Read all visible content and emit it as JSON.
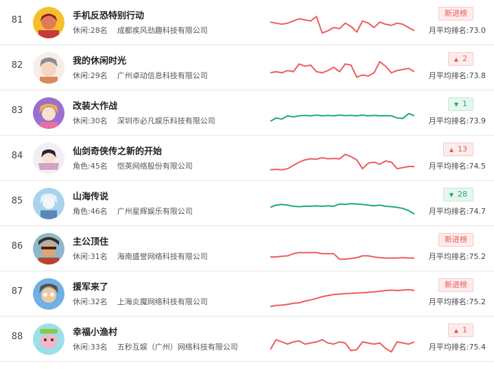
{
  "colors": {
    "up_line": "#ef5a5a",
    "down_line": "#1aaa73"
  },
  "rows": [
    {
      "rank": "81",
      "title": "手机反恐特别行动",
      "category": "休闲:28名",
      "company": "成都疾风劲趣科技有限公司",
      "badge_type": "new",
      "badge_text": "新进榜",
      "avg": "月平均排名:73.0",
      "trend": "red",
      "spark": [
        0.35,
        0.4,
        0.45,
        0.4,
        0.3,
        0.2,
        0.25,
        0.3,
        0.1,
        0.85,
        0.75,
        0.6,
        0.65,
        0.4,
        0.55,
        0.8,
        0.3,
        0.4,
        0.6,
        0.35,
        0.45,
        0.5,
        0.4,
        0.45,
        0.6,
        0.75
      ]
    },
    {
      "rank": "82",
      "title": "我的休闲时光",
      "category": "休闲:29名",
      "company": "广州卓动信息科技有限公司",
      "badge_type": "up",
      "badge_text": "2",
      "avg": "月平均排名:73.8",
      "trend": "red",
      "spark": [
        0.6,
        0.55,
        0.6,
        0.5,
        0.55,
        0.2,
        0.3,
        0.25,
        0.55,
        0.6,
        0.5,
        0.35,
        0.55,
        0.2,
        0.25,
        0.8,
        0.7,
        0.75,
        0.6,
        0.1,
        0.3,
        0.6,
        0.5,
        0.45,
        0.4,
        0.55
      ]
    },
    {
      "rank": "83",
      "title": "改装大作战",
      "category": "休闲:30名",
      "company": "深圳市必凡娱乐科技有限公司",
      "badge_type": "down",
      "badge_text": "1",
      "avg": "月平均排名:73.9",
      "trend": "green",
      "spark": [
        0.75,
        0.6,
        0.65,
        0.5,
        0.55,
        0.5,
        0.48,
        0.5,
        0.47,
        0.5,
        0.48,
        0.5,
        0.47,
        0.49,
        0.48,
        0.5,
        0.47,
        0.5,
        0.48,
        0.5,
        0.49,
        0.5,
        0.6,
        0.62,
        0.4,
        0.5
      ]
    },
    {
      "rank": "84",
      "title": "仙剑奇侠传之新的开始",
      "category": "角色:45名",
      "company": "恺英网络股份有限公司",
      "badge_type": "up",
      "badge_text": "13",
      "avg": "月平均排名:74.5",
      "trend": "red",
      "spark": [
        0.9,
        0.88,
        0.9,
        0.85,
        0.7,
        0.55,
        0.45,
        0.4,
        0.42,
        0.35,
        0.4,
        0.38,
        0.4,
        0.2,
        0.3,
        0.45,
        0.85,
        0.6,
        0.55,
        0.65,
        0.5,
        0.55,
        0.85,
        0.8,
        0.75,
        0.75
      ]
    },
    {
      "rank": "85",
      "title": "山海传说",
      "category": "角色:46名",
      "company": "广州星辉娱乐有限公司",
      "badge_type": "down",
      "badge_text": "28",
      "avg": "月平均排名:74.7",
      "trend": "green",
      "spark": [
        0.55,
        0.45,
        0.42,
        0.45,
        0.5,
        0.52,
        0.5,
        0.5,
        0.48,
        0.5,
        0.48,
        0.5,
        0.4,
        0.42,
        0.38,
        0.4,
        0.42,
        0.45,
        0.48,
        0.45,
        0.5,
        0.52,
        0.55,
        0.6,
        0.7,
        0.85
      ]
    },
    {
      "rank": "86",
      "title": "主公顶住",
      "category": "休闲:31名",
      "company": "海南盛誉网络科技有限公司",
      "badge_type": "new",
      "badge_text": "新进榜",
      "avg": "月平均排名:75.2",
      "trend": "red",
      "spark": [
        0.75,
        0.75,
        0.72,
        0.7,
        0.6,
        0.55,
        0.55,
        0.55,
        0.55,
        0.6,
        0.6,
        0.6,
        0.85,
        0.85,
        0.82,
        0.78,
        0.7,
        0.7,
        0.75,
        0.78,
        0.8,
        0.8,
        0.8,
        0.78,
        0.8,
        0.8
      ]
    },
    {
      "rank": "87",
      "title": "援军来了",
      "category": "休闲:32名",
      "company": "上海炎魔网络科技有限公司",
      "badge_type": "new",
      "badge_text": "新进榜",
      "avg": "月平均排名:75.2",
      "trend": "red",
      "spark": [
        0.95,
        0.9,
        0.88,
        0.85,
        0.8,
        0.78,
        0.7,
        0.65,
        0.58,
        0.5,
        0.45,
        0.4,
        0.38,
        0.36,
        0.35,
        0.33,
        0.32,
        0.3,
        0.28,
        0.25,
        0.22,
        0.2,
        0.22,
        0.2,
        0.18,
        0.22
      ]
    },
    {
      "rank": "88",
      "title": "幸福小渔村",
      "category": "休闲:33名",
      "company": "五秒互娱（广州）网络科技有限公司",
      "badge_type": "up",
      "badge_text": "1",
      "avg": "月平均排名:75.4",
      "trend": "red",
      "spark": [
        0.85,
        0.4,
        0.5,
        0.6,
        0.5,
        0.45,
        0.6,
        0.55,
        0.5,
        0.4,
        0.55,
        0.6,
        0.5,
        0.55,
        0.9,
        0.85,
        0.5,
        0.55,
        0.6,
        0.55,
        0.8,
        0.95,
        0.5,
        0.55,
        0.6,
        0.5
      ]
    }
  ]
}
